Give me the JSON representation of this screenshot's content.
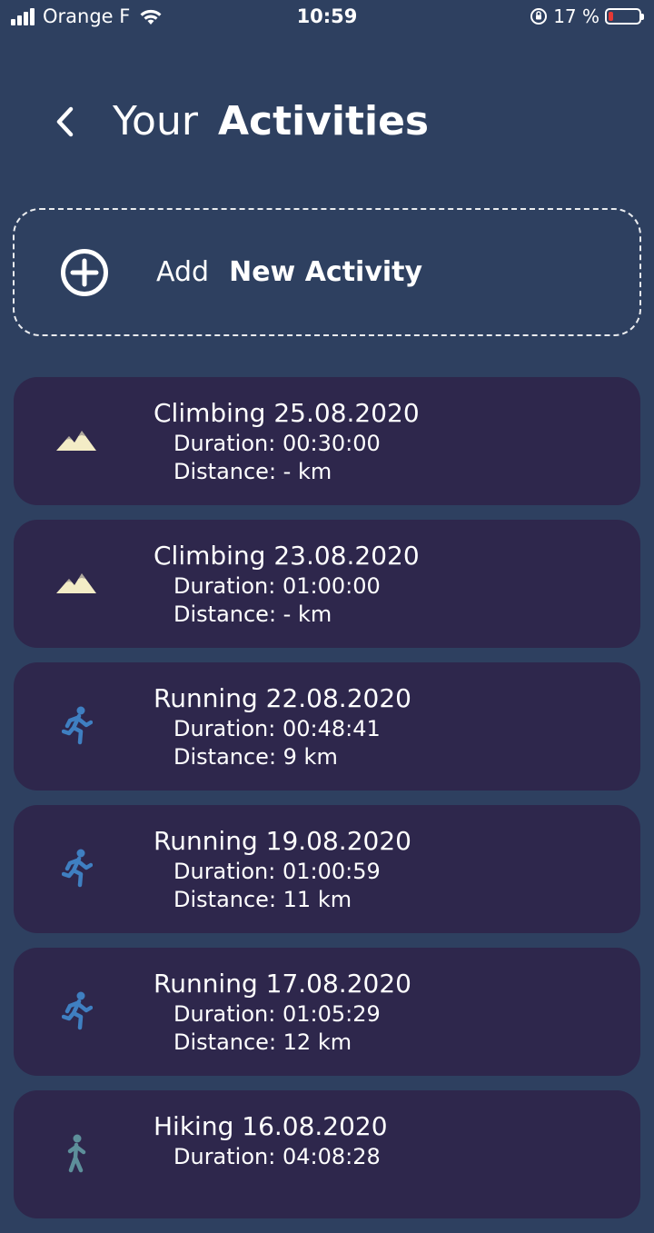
{
  "status_bar": {
    "carrier": "Orange F",
    "time": "10:59",
    "battery_percent": "17 %",
    "battery_level": 0.17,
    "icons": [
      "signal-icon",
      "wifi-icon",
      "rotation-lock-icon",
      "battery-icon"
    ]
  },
  "header": {
    "title_light": "Your",
    "title_bold": "Activities",
    "back_icon": "chevron-left-icon"
  },
  "add_card": {
    "label_light": "Add",
    "label_bold": "New Activity",
    "icon": "plus-circle-icon"
  },
  "activities": [
    {
      "title": "Climbing 25.08.2020",
      "duration": "Duration: 00:30:00",
      "distance": "Distance: - km",
      "icon": "mountain-icon"
    },
    {
      "title": "Climbing 23.08.2020",
      "duration": "Duration: 01:00:00",
      "distance": "Distance: - km",
      "icon": "mountain-icon"
    },
    {
      "title": "Running 22.08.2020",
      "duration": "Duration: 00:48:41",
      "distance": "Distance: 9 km",
      "icon": "runner-icon"
    },
    {
      "title": "Running 19.08.2020",
      "duration": "Duration: 01:00:59",
      "distance": "Distance: 11 km",
      "icon": "runner-icon"
    },
    {
      "title": "Running 17.08.2020",
      "duration": "Duration: 01:05:29",
      "distance": "Distance: 12 km",
      "icon": "runner-icon"
    },
    {
      "title": "Hiking 16.08.2020",
      "duration": "Duration: 04:08:28",
      "distance": "",
      "icon": "hiker-icon"
    }
  ],
  "colors": {
    "background": "#2e4060",
    "card": "#2e274c",
    "mountain": "#f3ecc6",
    "runner": "#3f7fc1",
    "hiker": "#5d8f9a"
  }
}
